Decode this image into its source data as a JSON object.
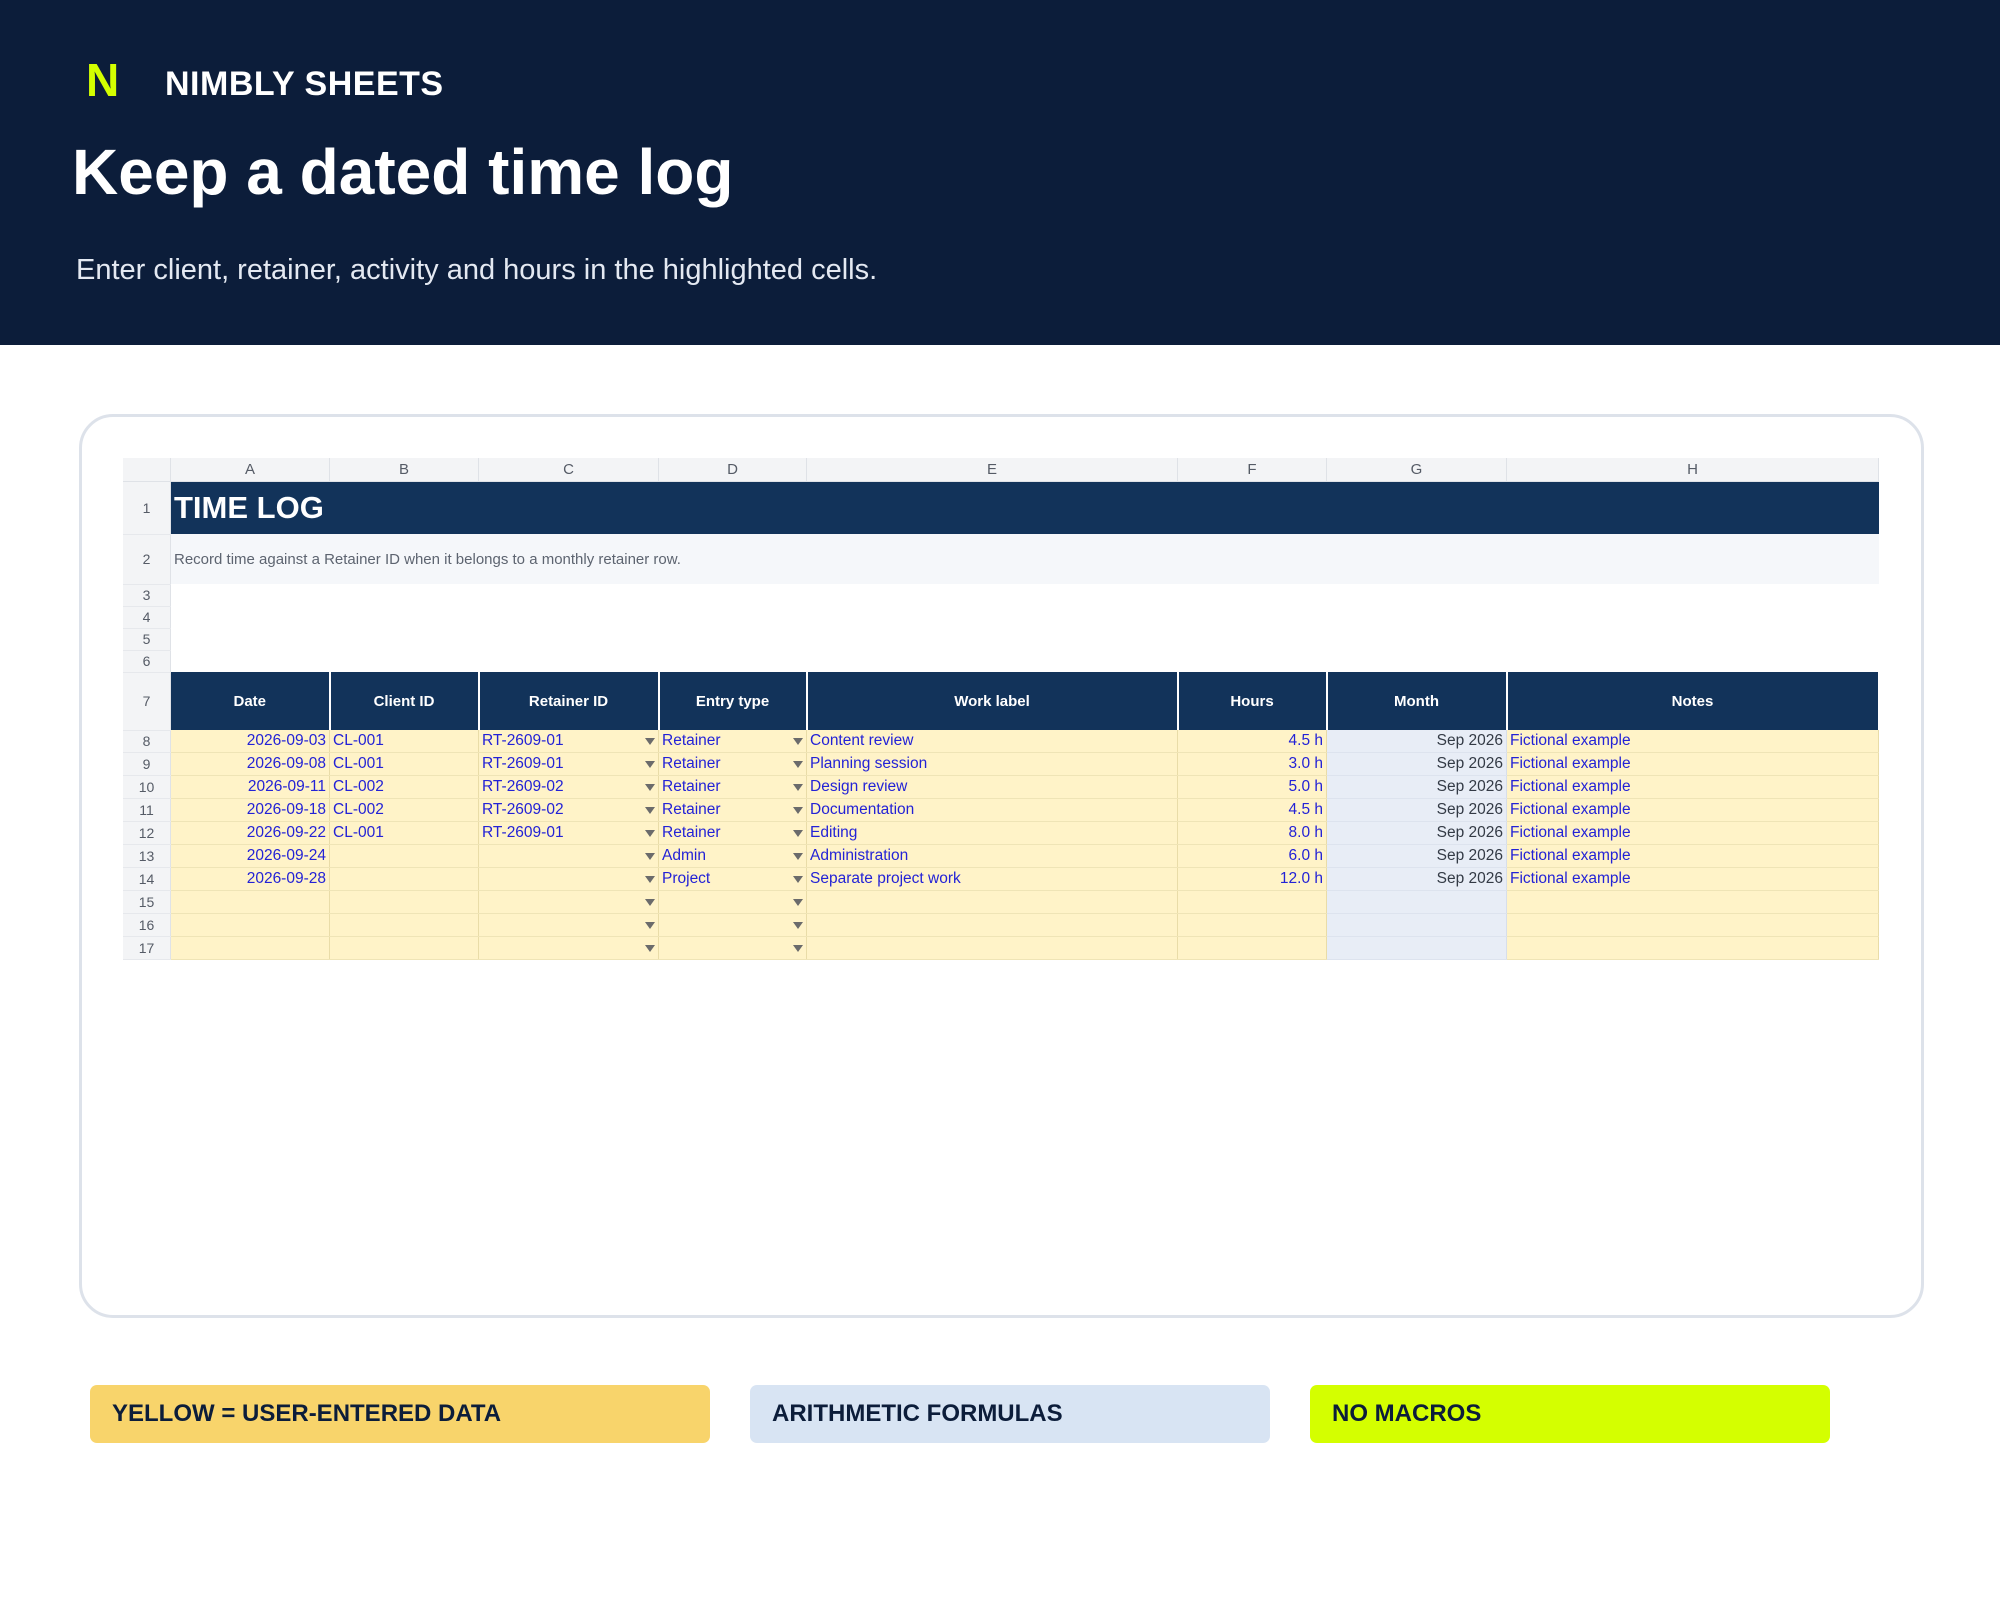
{
  "brand": {
    "mark": "N",
    "name": "NIMBLY SHEETS"
  },
  "hero": {
    "title": "Keep a dated time log",
    "subtitle": "Enter client, retainer, activity and hours in the highlighted cells."
  },
  "sheet": {
    "columns": [
      "A",
      "B",
      "C",
      "D",
      "E",
      "F",
      "G",
      "H"
    ],
    "title": "TIME LOG",
    "description": "Record time against a Retainer ID when it belongs to a monthly retainer row.",
    "headers": [
      "Date",
      "Client ID",
      "Retainer ID",
      "Entry type",
      "Work label",
      "Hours",
      "Month",
      "Notes"
    ],
    "row_numbers": {
      "title": "1",
      "description": "2",
      "blank": [
        "3",
        "4",
        "5",
        "6"
      ],
      "header": "7",
      "data": [
        "8",
        "9",
        "10",
        "11",
        "12",
        "13",
        "14",
        "15",
        "16",
        "17"
      ]
    },
    "rows": [
      {
        "date": "2026-09-03",
        "client": "CL-001",
        "retainer": "RT-2609-01",
        "type": "Retainer",
        "label": "Content review",
        "hours": "4.5 h",
        "month": "Sep 2026",
        "notes": "Fictional example"
      },
      {
        "date": "2026-09-08",
        "client": "CL-001",
        "retainer": "RT-2609-01",
        "type": "Retainer",
        "label": "Planning session",
        "hours": "3.0 h",
        "month": "Sep 2026",
        "notes": "Fictional example"
      },
      {
        "date": "2026-09-11",
        "client": "CL-002",
        "retainer": "RT-2609-02",
        "type": "Retainer",
        "label": "Design review",
        "hours": "5.0 h",
        "month": "Sep 2026",
        "notes": "Fictional example"
      },
      {
        "date": "2026-09-18",
        "client": "CL-002",
        "retainer": "RT-2609-02",
        "type": "Retainer",
        "label": "Documentation",
        "hours": "4.5 h",
        "month": "Sep 2026",
        "notes": "Fictional example"
      },
      {
        "date": "2026-09-22",
        "client": "CL-001",
        "retainer": "RT-2609-01",
        "type": "Retainer",
        "label": "Editing",
        "hours": "8.0 h",
        "month": "Sep 2026",
        "notes": "Fictional example"
      },
      {
        "date": "2026-09-24",
        "client": "",
        "retainer": "",
        "type": "Admin",
        "label": "Administration",
        "hours": "6.0 h",
        "month": "Sep 2026",
        "notes": "Fictional example"
      },
      {
        "date": "2026-09-28",
        "client": "",
        "retainer": "",
        "type": "Project",
        "label": "Separate project work",
        "hours": "12.0 h",
        "month": "Sep 2026",
        "notes": "Fictional example"
      },
      {
        "date": "",
        "client": "",
        "retainer": "",
        "type": "",
        "label": "",
        "hours": "",
        "month": "",
        "notes": ""
      },
      {
        "date": "",
        "client": "",
        "retainer": "",
        "type": "",
        "label": "",
        "hours": "",
        "month": "",
        "notes": ""
      },
      {
        "date": "",
        "client": "",
        "retainer": "",
        "type": "",
        "label": "",
        "hours": "",
        "month": "",
        "notes": ""
      }
    ]
  },
  "legend": {
    "yellow": "YELLOW = USER-ENTERED DATA",
    "blue": "ARITHMETIC FORMULAS",
    "lime": "NO MACROS"
  },
  "colors": {
    "navy": "#0c1d3a",
    "header_navy": "#12335a",
    "input_yellow": "#fff3c8",
    "formula_blue": "#e8edf6",
    "accent_lime": "#d4ff00",
    "input_text": "#2322d6"
  }
}
